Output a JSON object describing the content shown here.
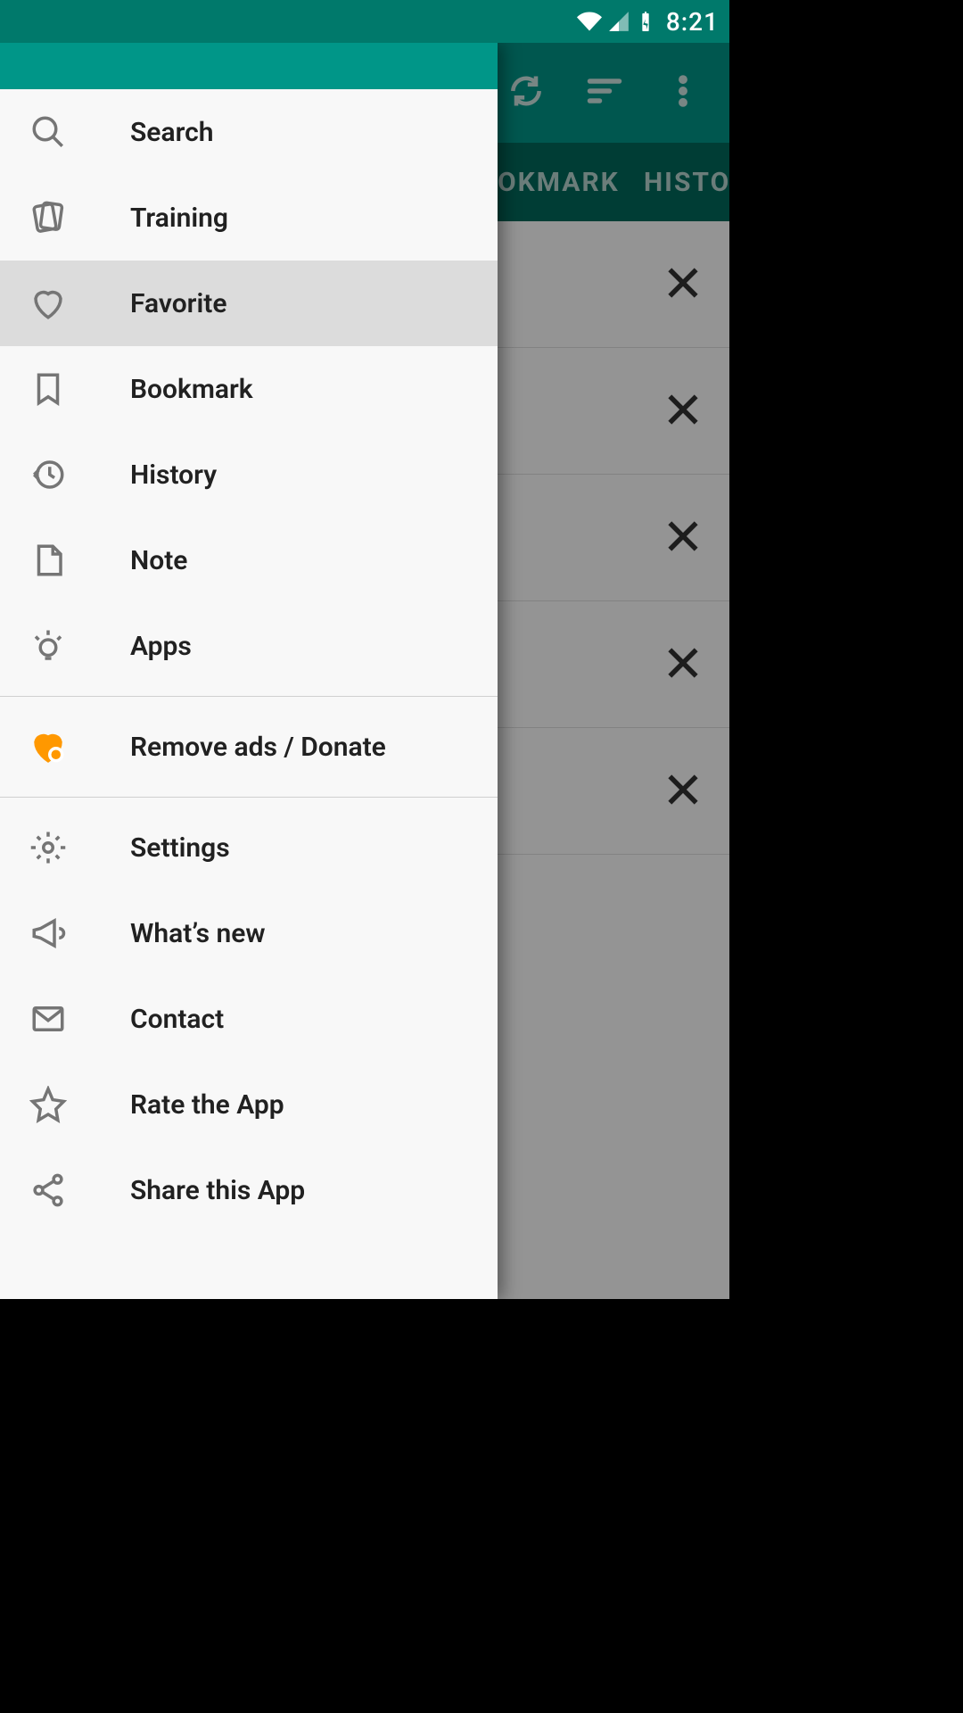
{
  "status": {
    "time": "8:21"
  },
  "tabs": {
    "bookmark": "OKMARK",
    "history": "HISTOR"
  },
  "drawer": {
    "items": [
      {
        "icon": "search",
        "label": "Search"
      },
      {
        "icon": "training",
        "label": "Training"
      },
      {
        "icon": "favorite",
        "label": "Favorite",
        "selected": true
      },
      {
        "icon": "bookmark",
        "label": "Bookmark"
      },
      {
        "icon": "history",
        "label": "History"
      },
      {
        "icon": "note",
        "label": "Note"
      },
      {
        "icon": "apps",
        "label": "Apps"
      }
    ],
    "donate": {
      "label": "Remove ads / Donate"
    },
    "items2": [
      {
        "icon": "settings",
        "label": "Settings"
      },
      {
        "icon": "news",
        "label": "What’s new"
      },
      {
        "icon": "contact",
        "label": "Contact"
      },
      {
        "icon": "rate",
        "label": "Rate the App"
      },
      {
        "icon": "share",
        "label": "Share this App"
      }
    ]
  },
  "bg_list_count": 5,
  "colors": {
    "primary": "#009688",
    "primary_dark": "#00796B",
    "accent": "#FF9800"
  }
}
